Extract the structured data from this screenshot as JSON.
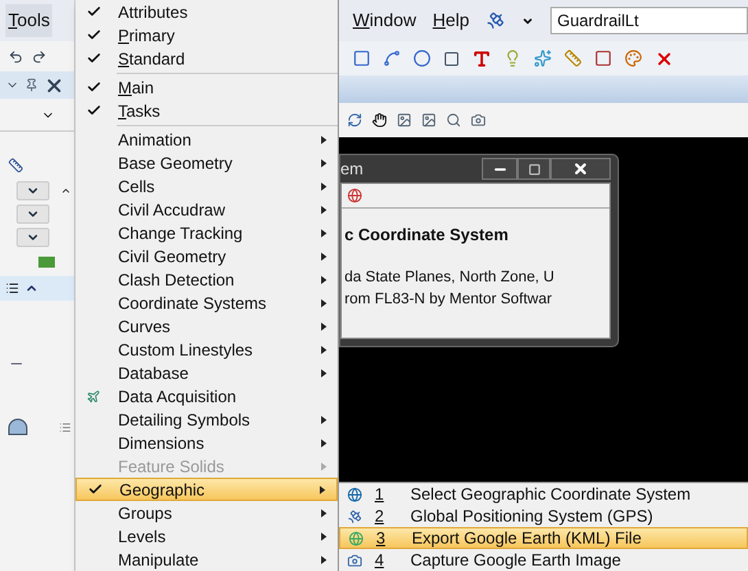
{
  "left_menubar": {
    "label": "Tools",
    "mnemonic": true
  },
  "menu": {
    "items": [
      {
        "kind": "item",
        "label": "Attributes",
        "checked": true,
        "mnemonic": false,
        "submenu": false,
        "disabled": false,
        "selected": false
      },
      {
        "kind": "item",
        "label": "Primary",
        "checked": true,
        "mnemonic": true,
        "submenu": false,
        "disabled": false,
        "selected": false
      },
      {
        "kind": "item",
        "label": "Standard",
        "checked": true,
        "mnemonic": true,
        "submenu": false,
        "disabled": false,
        "selected": false
      },
      {
        "kind": "separator"
      },
      {
        "kind": "item",
        "label": "Main",
        "checked": true,
        "mnemonic": true,
        "submenu": false,
        "disabled": false,
        "selected": false
      },
      {
        "kind": "item",
        "label": "Tasks",
        "checked": true,
        "mnemonic": true,
        "submenu": false,
        "disabled": false,
        "selected": false
      },
      {
        "kind": "separator"
      },
      {
        "kind": "item",
        "label": "Animation",
        "checked": false,
        "mnemonic": false,
        "submenu": true,
        "disabled": false,
        "selected": false
      },
      {
        "kind": "item",
        "label": "Base Geometry",
        "checked": false,
        "mnemonic": false,
        "submenu": true,
        "disabled": false,
        "selected": false
      },
      {
        "kind": "item",
        "label": "Cells",
        "checked": false,
        "mnemonic": false,
        "submenu": true,
        "disabled": false,
        "selected": false
      },
      {
        "kind": "item",
        "label": "Civil Accudraw",
        "checked": false,
        "mnemonic": false,
        "submenu": true,
        "disabled": false,
        "selected": false
      },
      {
        "kind": "item",
        "label": "Change Tracking",
        "checked": false,
        "mnemonic": false,
        "submenu": true,
        "disabled": false,
        "selected": false
      },
      {
        "kind": "item",
        "label": "Civil Geometry",
        "checked": false,
        "mnemonic": false,
        "submenu": true,
        "disabled": false,
        "selected": false
      },
      {
        "kind": "item",
        "label": "Clash Detection",
        "checked": false,
        "mnemonic": false,
        "submenu": true,
        "disabled": false,
        "selected": false
      },
      {
        "kind": "item",
        "label": "Coordinate Systems",
        "checked": false,
        "mnemonic": false,
        "submenu": true,
        "disabled": false,
        "selected": false
      },
      {
        "kind": "item",
        "label": "Curves",
        "checked": false,
        "mnemonic": false,
        "submenu": true,
        "disabled": false,
        "selected": false
      },
      {
        "kind": "item",
        "label": "Custom Linestyles",
        "checked": false,
        "mnemonic": false,
        "submenu": true,
        "disabled": false,
        "selected": false
      },
      {
        "kind": "item",
        "label": "Database",
        "checked": false,
        "mnemonic": false,
        "submenu": true,
        "disabled": false,
        "selected": false
      },
      {
        "kind": "tool",
        "label": "Data Acquisition",
        "checked": false,
        "mnemonic": false,
        "submenu": false,
        "disabled": false,
        "selected": false
      },
      {
        "kind": "item",
        "label": "Detailing Symbols",
        "checked": false,
        "mnemonic": false,
        "submenu": true,
        "disabled": false,
        "selected": false
      },
      {
        "kind": "item",
        "label": "Dimensions",
        "checked": false,
        "mnemonic": false,
        "submenu": true,
        "disabled": false,
        "selected": false
      },
      {
        "kind": "item",
        "label": "Feature Solids",
        "checked": false,
        "mnemonic": false,
        "submenu": true,
        "disabled": true,
        "selected": false
      },
      {
        "kind": "item",
        "label": "Geographic",
        "checked": true,
        "mnemonic": false,
        "submenu": true,
        "disabled": false,
        "selected": true
      },
      {
        "kind": "item",
        "label": "Groups",
        "checked": false,
        "mnemonic": false,
        "submenu": true,
        "disabled": false,
        "selected": false
      },
      {
        "kind": "item",
        "label": "Levels",
        "checked": false,
        "mnemonic": false,
        "submenu": true,
        "disabled": false,
        "selected": false
      },
      {
        "kind": "item",
        "label": "Manipulate",
        "checked": false,
        "mnemonic": false,
        "submenu": true,
        "disabled": false,
        "selected": false
      }
    ]
  },
  "menubar": {
    "items": [
      {
        "label": "Window",
        "mnemonic": true
      },
      {
        "label": "Help",
        "mnemonic": true
      }
    ],
    "model_field": {
      "value": "GuardrailLt"
    }
  },
  "dialog": {
    "title": "em",
    "heading": "c Coordinate System",
    "lines": [
      "da State Planes, North Zone, U",
      "rom FL83-N by Mentor Softwar"
    ]
  },
  "submenu": {
    "items": [
      {
        "number": "1",
        "label": "Select Geographic Coordinate System",
        "selected": false
      },
      {
        "number": "2",
        "label": "Global Positioning System (GPS)",
        "selected": false
      },
      {
        "number": "3",
        "label": "Export Google Earth (KML) File",
        "selected": true
      },
      {
        "number": "4",
        "label": "Capture Google Earth Image",
        "selected": false
      }
    ]
  }
}
